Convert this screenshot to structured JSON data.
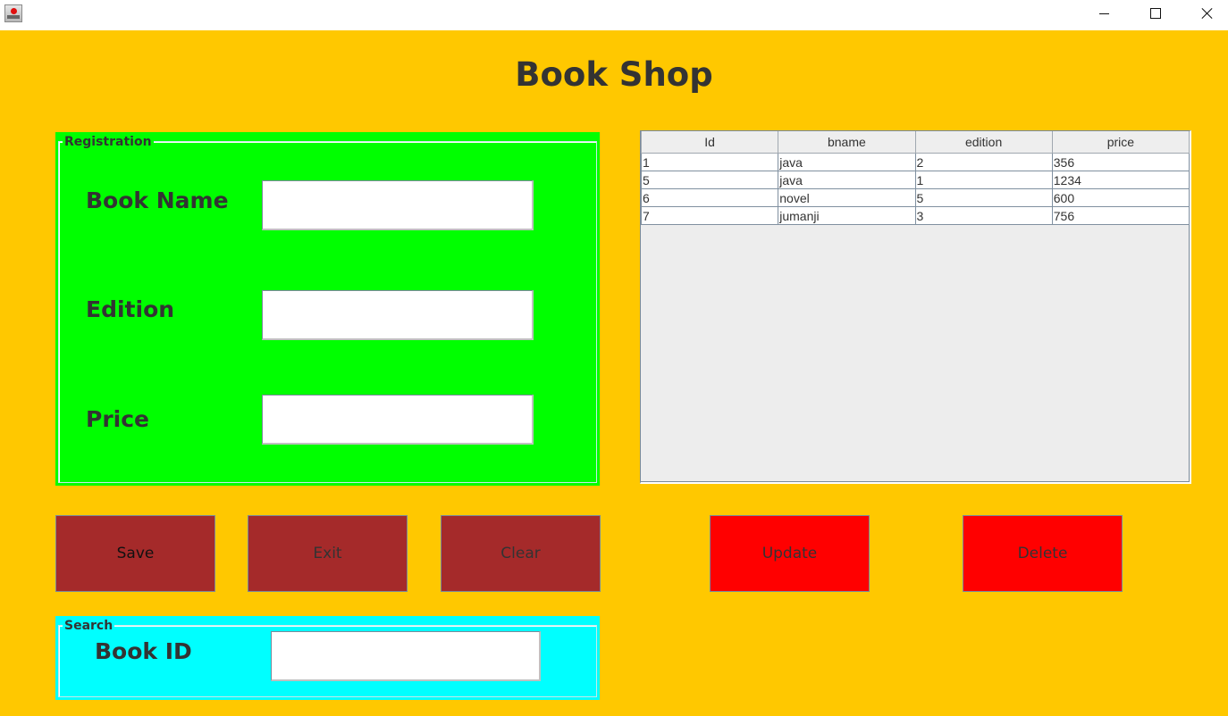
{
  "window": {
    "icon": "java-app-icon",
    "controls": {
      "minimize": "minimize-icon",
      "maximize": "maximize-icon",
      "close": "close-icon"
    }
  },
  "header": {
    "title": "Book Shop"
  },
  "registration": {
    "legend": "Registration",
    "fields": [
      {
        "label": "Book Name",
        "value": "",
        "placeholder": ""
      },
      {
        "label": "Edition",
        "value": "",
        "placeholder": ""
      },
      {
        "label": "Price",
        "value": "",
        "placeholder": ""
      }
    ]
  },
  "search": {
    "legend": "Search",
    "label": "Book ID",
    "value": "",
    "placeholder": ""
  },
  "buttons": {
    "save": {
      "label": "Save",
      "color": "#a52a2a",
      "text_color": "#111111"
    },
    "exit": {
      "label": "Exit",
      "color": "#a52a2a",
      "text_color": "#333333"
    },
    "clear": {
      "label": "Clear",
      "color": "#a52a2a",
      "text_color": "#333333"
    },
    "update": {
      "label": "Update",
      "color": "#ff0000",
      "text_color": "#333333"
    },
    "delete": {
      "label": "Delete",
      "color": "#ff0000",
      "text_color": "#333333"
    }
  },
  "table": {
    "columns": [
      "Id",
      "bname",
      "edition",
      "price"
    ],
    "rows": [
      [
        "1",
        "java",
        "2",
        "356"
      ],
      [
        "5",
        "java",
        "1",
        "1234"
      ],
      [
        "6",
        "novel",
        "5",
        "600"
      ],
      [
        "7",
        "jumanji",
        "3",
        "756"
      ]
    ]
  },
  "colors": {
    "background": "#ffc800",
    "registration_panel": "#00ff00",
    "search_panel": "#00ffff",
    "table_background": "#ededed"
  }
}
